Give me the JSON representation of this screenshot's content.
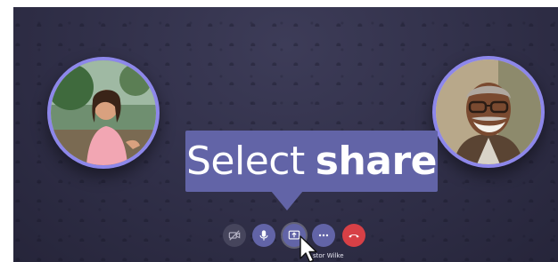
{
  "callout": {
    "text_regular": "Select",
    "text_bold": "share"
  },
  "participants": {
    "left": {
      "icon": "woman-photo"
    },
    "right": {
      "icon": "man-photo"
    },
    "name_label": "stor Wilke"
  },
  "controls": {
    "items": [
      {
        "id": "camera",
        "icon": "video-off-icon"
      },
      {
        "id": "mic",
        "icon": "microphone-icon"
      },
      {
        "id": "share",
        "icon": "share-screen-icon"
      },
      {
        "id": "more",
        "icon": "more-options-icon"
      },
      {
        "id": "hangup",
        "icon": "hang-up-icon"
      }
    ]
  },
  "colors": {
    "accent": "#6264a7",
    "ring": "#8d87ea",
    "hangup": "#d74046",
    "background": "#302f48"
  }
}
